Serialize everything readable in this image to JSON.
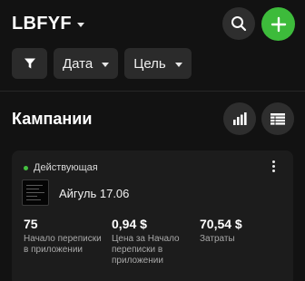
{
  "header": {
    "account_name": "LBFYF",
    "icons": {
      "dropdown": "caret-down-icon",
      "search": "search-icon",
      "add": "plus-icon"
    }
  },
  "filters": {
    "funnel_icon": "funnel-icon",
    "date_label": "Дата",
    "goal_label": "Цель"
  },
  "campaigns": {
    "title": "Кампании",
    "view_icons": [
      "bar-chart-icon",
      "table-icon"
    ]
  },
  "card": {
    "status": "Действующая",
    "status_color": "#45c141",
    "name": "Айгуль 17.06",
    "metrics": [
      {
        "value": "75",
        "label": "Начало переписки в приложении"
      },
      {
        "value": "0,94 $",
        "label": "Цена за Начало переписки в приложении"
      },
      {
        "value": "70,54 $",
        "label": "Затраты"
      }
    ]
  },
  "colors": {
    "background": "#121212",
    "accent_green": "#3dbb3b",
    "chip": "#2b2b2b"
  }
}
